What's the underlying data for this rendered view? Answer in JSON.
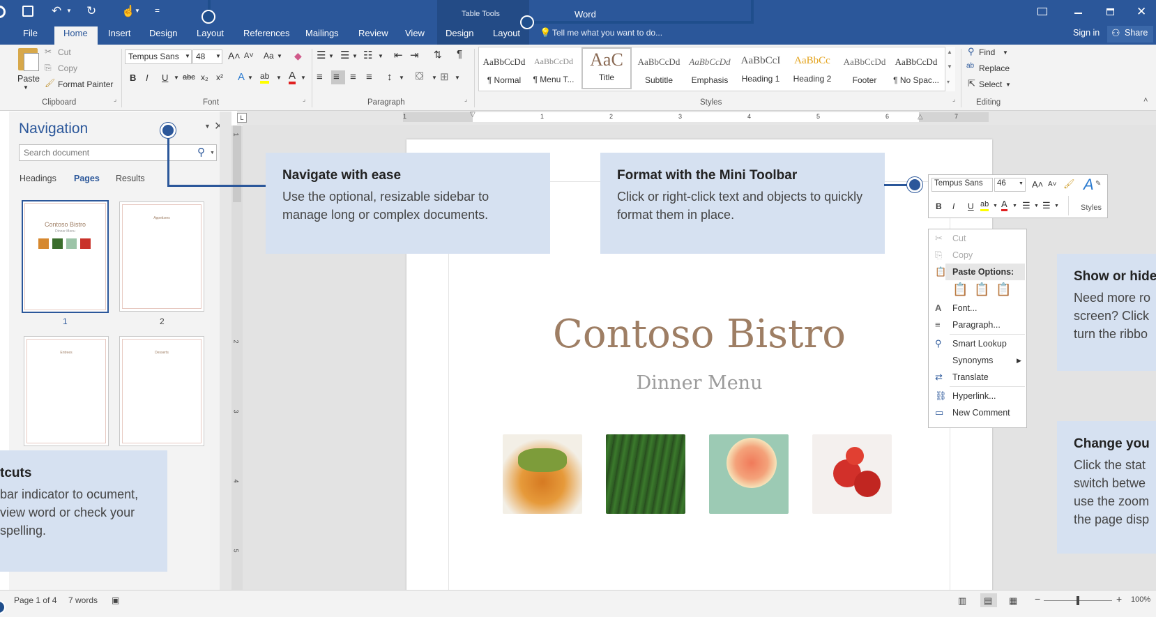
{
  "titlebar": {
    "app_title": "Word",
    "context_group": "Table Tools",
    "qat_more": "="
  },
  "tabs": [
    "File",
    "Home",
    "Insert",
    "Design",
    "Layout",
    "References",
    "Mailings",
    "Review",
    "View"
  ],
  "context_tabs": [
    "Design",
    "Layout"
  ],
  "tell_me": "Tell me what you want to do...",
  "account": {
    "sign_in": "Sign in",
    "share": "Share"
  },
  "ribbon": {
    "clipboard": {
      "paste": "Paste",
      "cut": "Cut",
      "copy": "Copy",
      "format_painter": "Format Painter",
      "label": "Clipboard"
    },
    "font": {
      "name": "Tempus Sans",
      "size": "48",
      "case": "Aa",
      "label": "Font"
    },
    "paragraph": {
      "label": "Paragraph"
    },
    "styles": {
      "label": "Styles",
      "items": [
        {
          "sample": "AaBbCcDd",
          "name": "¶ Normal"
        },
        {
          "sample": "AaBbCcDd",
          "name": "¶ Menu T..."
        },
        {
          "sample": "AaC",
          "name": "Title"
        },
        {
          "sample": "AaBbCcDd",
          "name": "Subtitle"
        },
        {
          "sample": "AaBbCcDd",
          "name": "Emphasis"
        },
        {
          "sample": "AaBbCcI",
          "name": "Heading 1"
        },
        {
          "sample": "AaBbCc",
          "name": "Heading 2"
        },
        {
          "sample": "AaBbCcDd",
          "name": "Footer"
        },
        {
          "sample": "AaBbCcDd",
          "name": "¶ No Spac..."
        }
      ]
    },
    "editing": {
      "find": "Find",
      "replace": "Replace",
      "select": "Select",
      "label": "Editing"
    }
  },
  "navigation": {
    "title": "Navigation",
    "search_placeholder": "Search document",
    "tabs": [
      "Headings",
      "Pages",
      "Results"
    ],
    "active_tab": "Pages",
    "pages": [
      {
        "number": "1",
        "title": "Contoso Bistro",
        "subtitle": "Dinner Menu"
      },
      {
        "number": "2",
        "title": "Appetizers"
      },
      {
        "number": "",
        "title": "Entrees"
      },
      {
        "number": "",
        "title": "Desserts"
      }
    ]
  },
  "ruler": {
    "numbers": [
      "1",
      "1",
      "2",
      "3",
      "4",
      "5",
      "6",
      "7"
    ]
  },
  "vruler": {
    "numbers": [
      "1",
      "2",
      "3",
      "4",
      "5"
    ]
  },
  "document": {
    "title": "Contoso Bistro",
    "subtitle": "Dinner Menu"
  },
  "callouts": {
    "navigate": {
      "heading": "Navigate with ease",
      "body": "Use the optional, resizable sidebar to manage long or complex documents."
    },
    "mini_toolbar": {
      "heading": "Format with the Mini Toolbar",
      "body": "Click or right-click text and objects to quickly format them in place."
    },
    "show_hide": {
      "heading": "Show or hide",
      "body": "Need more ro screen? Click turn the ribbo"
    },
    "change": {
      "heading": "Change you",
      "body": "Click the stat switch betwe use the zoom the page disp"
    },
    "shortcuts": {
      "heading": "tcuts",
      "body": "bar indicator to ocument, view word or check your spelling."
    }
  },
  "mini_toolbar": {
    "font": "Tempus Sans",
    "size": "46",
    "styles": "Styles"
  },
  "context_menu": {
    "items": [
      "Cut",
      "Copy",
      "Paste Options:",
      "Font...",
      "Paragraph...",
      "Smart Lookup",
      "Synonyms",
      "Translate",
      "Hyperlink...",
      "New Comment"
    ]
  },
  "status": {
    "page": "Page 1 of 4",
    "words": "7 words",
    "zoom": "100%"
  },
  "colors": {
    "accent": "#2b579a",
    "callout": "#d6e1f1",
    "doc_title": "#9e7e64"
  }
}
